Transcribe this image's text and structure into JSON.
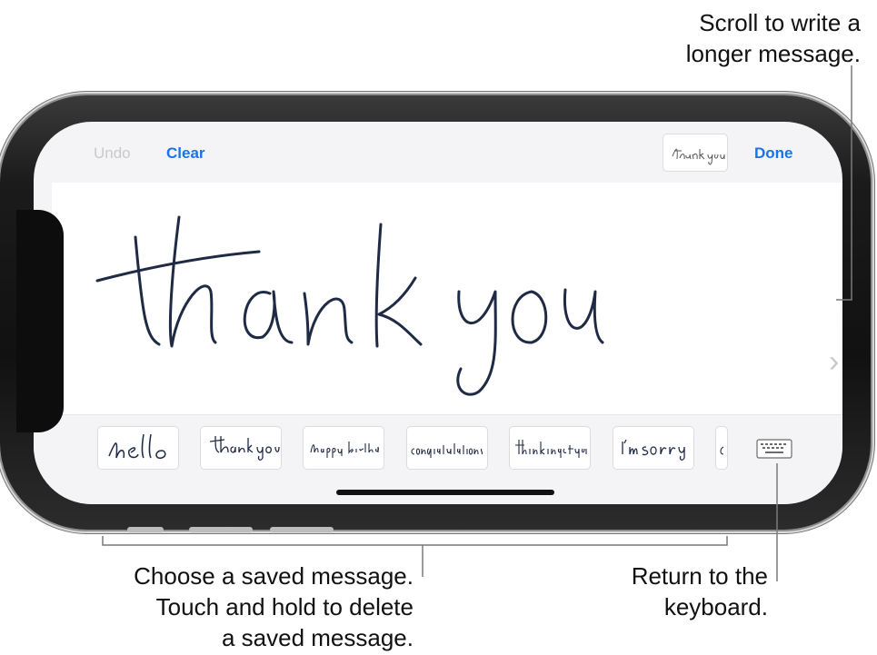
{
  "callouts": {
    "scroll": [
      "Scroll to write a",
      "longer message."
    ],
    "saved": [
      "Choose a saved message.",
      "Touch and hold to delete",
      "a saved message."
    ],
    "keyboard": [
      "Return to the",
      "keyboard."
    ]
  },
  "toolbar": {
    "undo_label": "Undo",
    "clear_label": "Clear",
    "done_label": "Done"
  },
  "saved_messages": [
    "hello",
    "thank you",
    "happy birthday",
    "congratulations",
    "thinking of you",
    "I'm sorry"
  ],
  "icons": {
    "scroll": "chevron-right-icon",
    "keyboard": "keyboard-icon"
  },
  "colors": {
    "accent": "#1a73e8",
    "disabled": "#c9c9cc",
    "ink": "#1f2a44"
  }
}
